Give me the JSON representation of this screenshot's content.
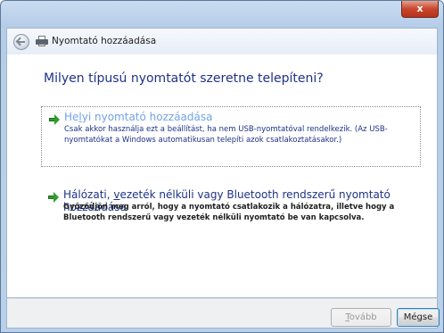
{
  "window": {
    "close_label": "x"
  },
  "header": {
    "title": "Nyomtató hozzáadása"
  },
  "main": {
    "question": "Milyen típusú nyomtatót szeretne telepíteni?",
    "options": [
      {
        "title_pre": "He",
        "title_access": "l",
        "title_post": "yi nyomtató hozzáadása",
        "description": "Csak akkor használja ezt a beállítást, ha nem USB-nyomtatóval rendelkezik. (Az USB-nyomtatókat a Windows automatikusan telepíti azok csatlakoztatásakor.)",
        "icon": "green-arrow-icon"
      },
      {
        "title_pre": "Hálózati, ",
        "title_access": "v",
        "title_post": "ezeték nélküli vagy Bluetooth rendszerű nyomtató hozzáadása",
        "description": "Győződjön meg arról, hogy a nyomtató csatlakozik a hálózatra, illetve hogy a Bluetooth rendszerű vagy vezeték nélküli nyomtató be van kapcsolva.",
        "icon": "green-arrow-icon"
      }
    ]
  },
  "footer": {
    "next_access": "T",
    "next_rest": "ovább",
    "cancel_label": "Mégse"
  },
  "colors": {
    "link_blue": "#1e3287",
    "hover_blue": "#73a3e6",
    "arrow_green": "#2e9e2e"
  }
}
